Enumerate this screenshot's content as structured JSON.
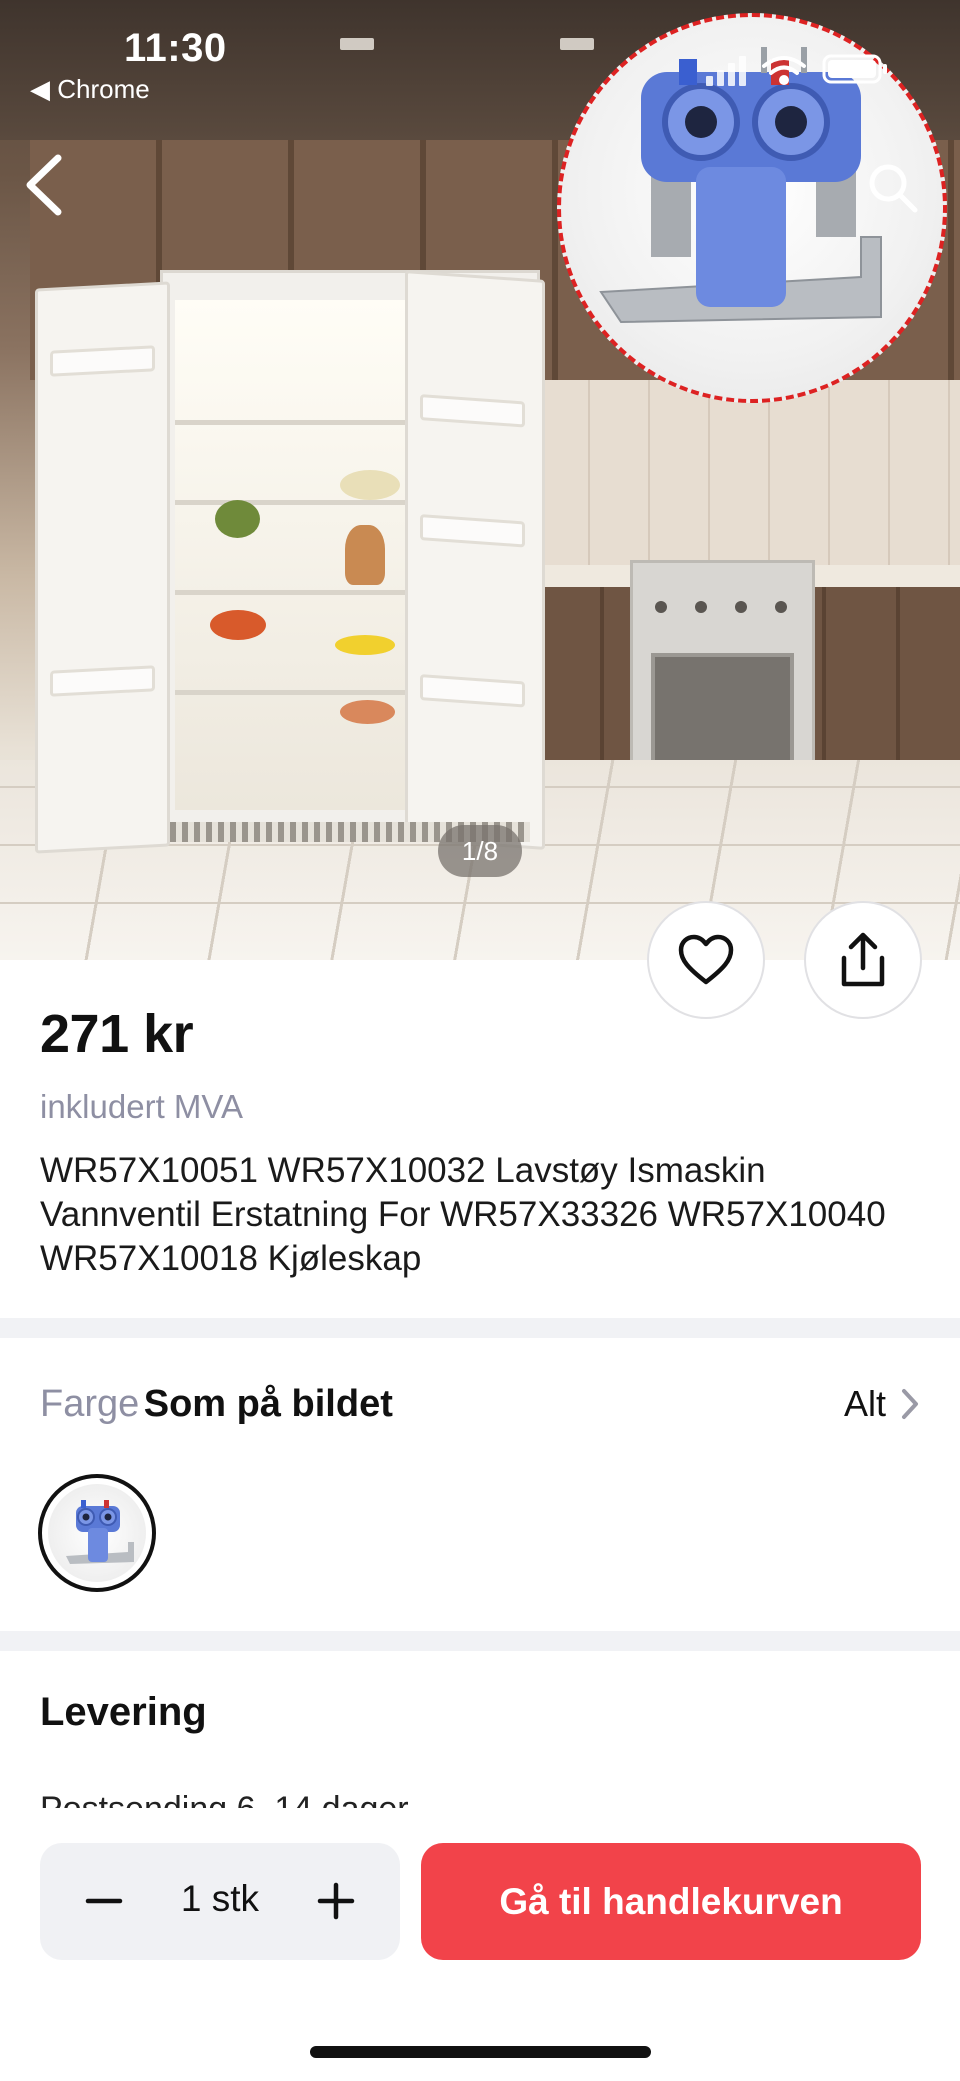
{
  "status_bar": {
    "time": "11:30",
    "back_app": "◀ Chrome"
  },
  "gallery": {
    "counter": "1/8"
  },
  "product": {
    "price": "271 kr",
    "vat_note": "inkludert MVA",
    "title": "WR57X10051 WR57X10032 Lavstøy Ismaskin Vannventil Erstatning For WR57X33326 WR57X10040 WR57X10018 Kjøleskap"
  },
  "variant": {
    "label": "Farge",
    "value": "Som på bildet",
    "all_link": "Alt"
  },
  "delivery": {
    "heading": "Levering",
    "peek_text": "Postsending 6–14 dager"
  },
  "cart_bar": {
    "quantity": "1 stk",
    "cart_button": "Gå til handlekurven"
  },
  "colors": {
    "accent": "#f2434a",
    "muted_text": "#8e8fa3",
    "divider": "#f1f2f5",
    "valve_blue": "#5a79d6"
  },
  "icons": {
    "back": "chevron-left-icon",
    "search": "search-icon",
    "favorite": "heart-icon",
    "share": "share-icon",
    "chevron": "chevron-right-icon",
    "minus": "minus-icon",
    "plus": "plus-icon"
  }
}
